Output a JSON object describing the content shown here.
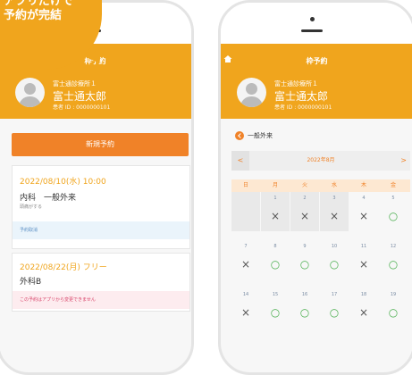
{
  "left_phone": {
    "header_title": "枠予約",
    "clinic": "富士通診療所１",
    "patient_name": "富士通太郎",
    "patient_id": "患者 ID : 0000000101",
    "new_booking_label": "新規予約",
    "reservations": [
      {
        "date": "2022/08/10(水) 10:00",
        "dept": "内科　一般外来",
        "note": "頭痛がする",
        "action": "予約取消"
      },
      {
        "date": "2022/08/22(月) フリー",
        "dept": "外科B",
        "note": "",
        "action": "この予約はアプリから変更できません"
      }
    ]
  },
  "callout": {
    "line1": "アプリだけで",
    "line2": "予約が完結"
  },
  "right_phone": {
    "header_title": "枠予約",
    "clinic": "富士通診療所１",
    "patient_name": "富士通太郎",
    "patient_id": "患者 ID : 0000000101",
    "back_label": "一般外来",
    "prev_label": "<",
    "month_label": "2022年8月",
    "next_label": ">",
    "weekdays": [
      "日",
      "月",
      "火",
      "水",
      "木",
      "金"
    ],
    "weeks": [
      [
        {
          "day": "",
          "mark": ""
        },
        {
          "day": "1",
          "mark": "×"
        },
        {
          "day": "2",
          "mark": "×"
        },
        {
          "day": "3",
          "mark": "×"
        },
        {
          "day": "4",
          "mark": "×"
        },
        {
          "day": "5",
          "mark": "○"
        }
      ],
      [
        {
          "day": "7",
          "mark": "×"
        },
        {
          "day": "8",
          "mark": "○"
        },
        {
          "day": "9",
          "mark": "○"
        },
        {
          "day": "10",
          "mark": "○"
        },
        {
          "day": "11",
          "mark": "×"
        },
        {
          "day": "12",
          "mark": "○"
        }
      ],
      [
        {
          "day": "14",
          "mark": "×"
        },
        {
          "day": "15",
          "mark": "○"
        },
        {
          "day": "16",
          "mark": "○"
        },
        {
          "day": "17",
          "mark": "○"
        },
        {
          "day": "18",
          "mark": "×"
        },
        {
          "day": "19",
          "mark": "○"
        }
      ]
    ]
  },
  "colors": {
    "header": "#f0a51d",
    "button": "#f08228",
    "available": "#4caf50"
  }
}
